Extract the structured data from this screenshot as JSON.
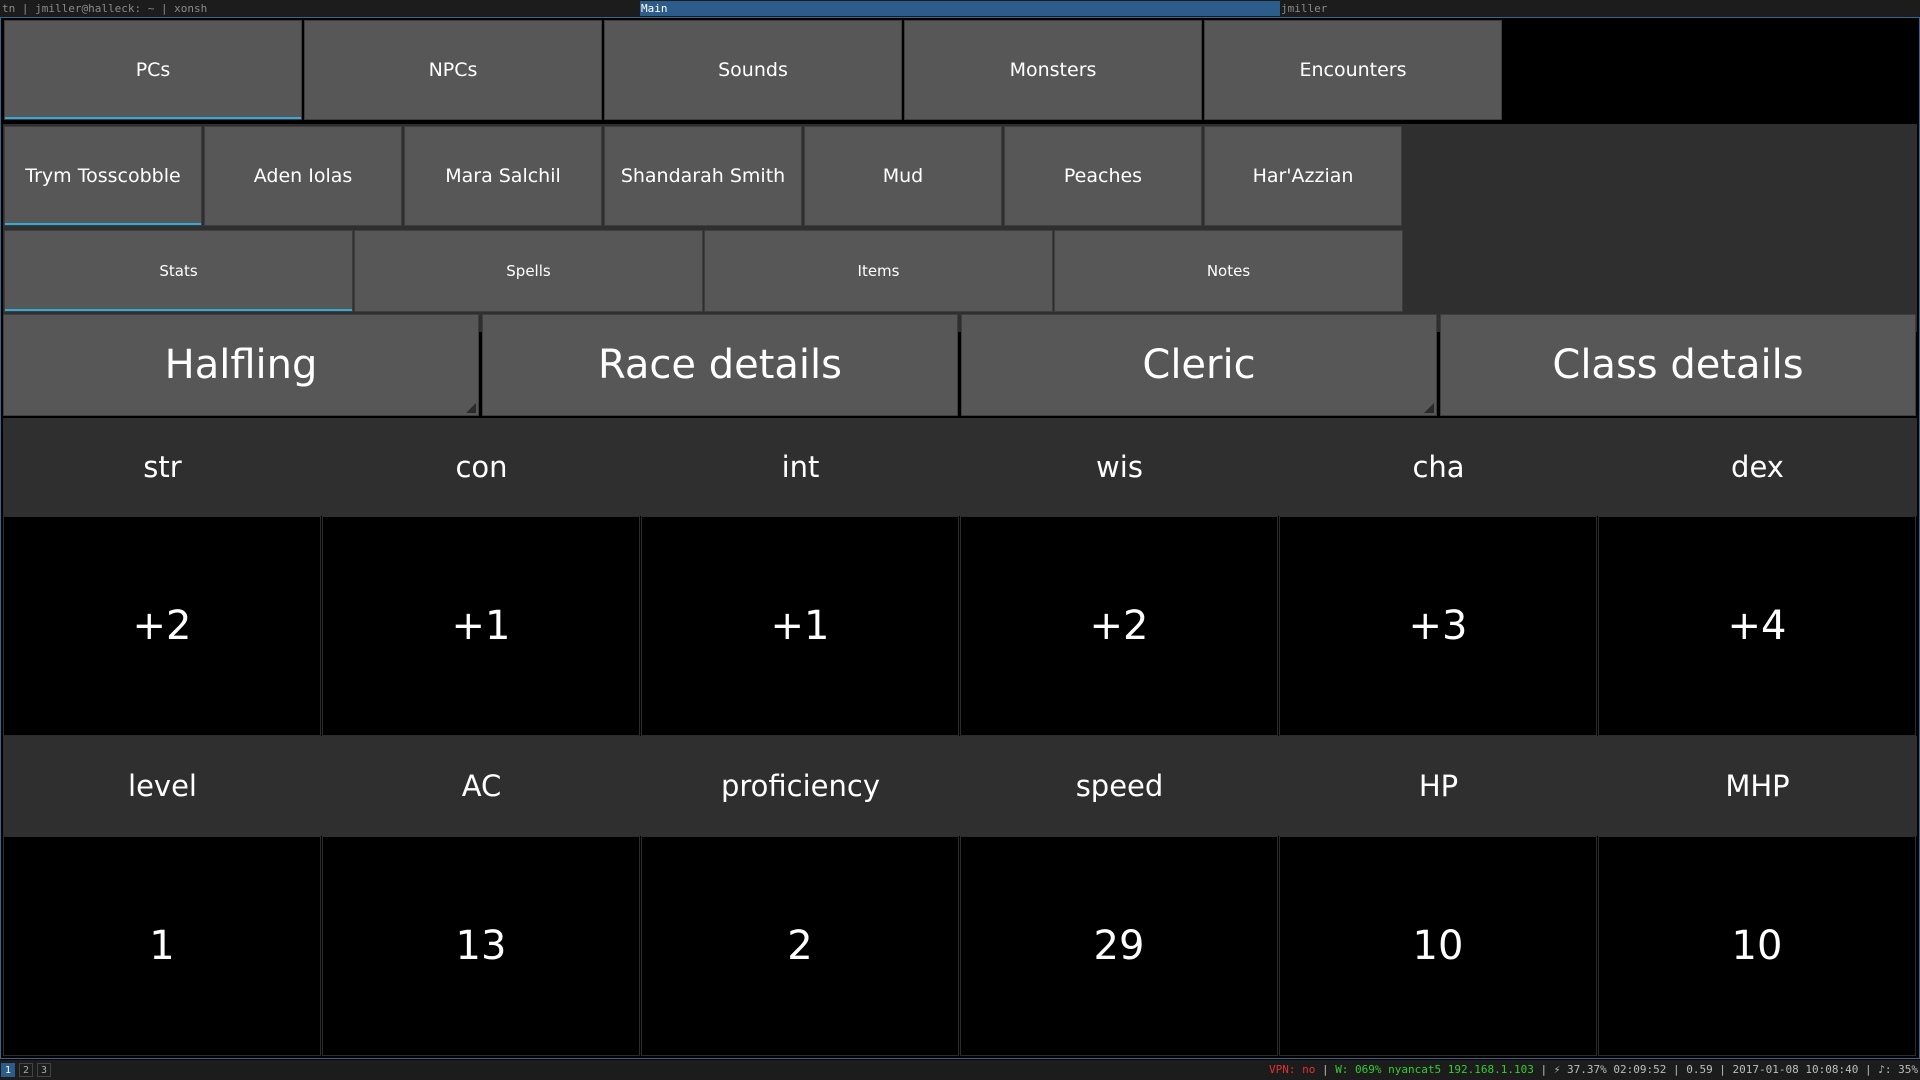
{
  "wm": {
    "left": "tn | jmiller@halleck: ~ | xonsh",
    "title": "Main",
    "right": "jmiller"
  },
  "tabs": [
    "PCs",
    "NPCs",
    "Sounds",
    "Monsters",
    "Encounters"
  ],
  "characters": [
    "Trym Tosscobble",
    "Aden Iolas",
    "Mara Salchil",
    "Shandarah Smith",
    "Mud",
    "Peaches",
    "Har'Azzian"
  ],
  "subtabs": [
    "Stats",
    "Spells",
    "Items",
    "Notes"
  ],
  "dropdowns": {
    "race": "Halfling",
    "race_details": "Race details",
    "class": "Cleric",
    "class_details": "Class details"
  },
  "abilities": {
    "labels": [
      "str",
      "con",
      "int",
      "wis",
      "cha",
      "dex"
    ],
    "values": [
      "+2",
      "+1",
      "+1",
      "+2",
      "+3",
      "+4"
    ]
  },
  "stats": {
    "labels": [
      "level",
      "AC",
      "proficiency",
      "speed",
      "HP",
      "MHP"
    ],
    "values": [
      "1",
      "13",
      "2",
      "29",
      "10",
      "10"
    ]
  },
  "statusbar": {
    "workspaces": [
      "1",
      "2",
      "3"
    ],
    "vpn": "VPN: no",
    "wifi": "W: 069% nyancat5 192.168.1.103",
    "rest": "| ⚡ 37.37% 02:09:52 | 0.59 | 2017-01-08 10:08:40 | ♪: 35%"
  },
  "colors": {
    "accent": "#38a9d6",
    "wm_title_bg": "#2c5d8a",
    "button_bg": "#575757",
    "panel_bg": "#2f2f2f"
  }
}
